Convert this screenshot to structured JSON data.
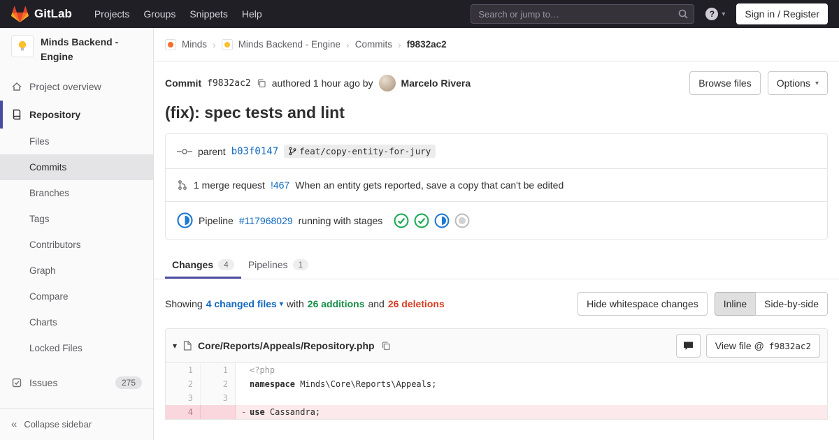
{
  "icons": {
    "caret_down": "▾",
    "chevron_right": "›",
    "collapse": "«",
    "question": "?"
  },
  "navbar": {
    "brand": "GitLab",
    "menu": [
      "Projects",
      "Groups",
      "Snippets",
      "Help"
    ],
    "search_placeholder": "Search or jump to…",
    "signin_label": "Sign in / Register"
  },
  "sidebar": {
    "project_title": "Minds Backend - Engine",
    "overview_label": "Project overview",
    "repository_label": "Repository",
    "repo_items": [
      "Files",
      "Commits",
      "Branches",
      "Tags",
      "Contributors",
      "Graph",
      "Compare",
      "Charts",
      "Locked Files"
    ],
    "issues_label": "Issues",
    "issues_count": "275",
    "collapse_label": "Collapse sidebar"
  },
  "breadcrumb": {
    "group": "Minds",
    "project": "Minds Backend - Engine",
    "section": "Commits",
    "current": "f9832ac2"
  },
  "commit": {
    "label": "Commit",
    "sha": "f9832ac2",
    "authored": "authored 1 hour ago by",
    "author": "Marcelo Rivera",
    "browse_files": "Browse files",
    "options": "Options",
    "title": "(fix): spec tests and lint",
    "parent_label": "parent",
    "parent_sha": "b03f0147",
    "branch_ref": "feat/copy-entity-for-jury",
    "mr_count_text": "1 merge request",
    "mr_ref": "!467",
    "mr_title": "When an entity gets reported, save a copy that can't be edited",
    "pipeline_label": "Pipeline",
    "pipeline_id": "#117968029",
    "pipeline_status_text": "running with stages"
  },
  "tabs": {
    "changes": "Changes",
    "changes_count": "4",
    "pipelines": "Pipelines",
    "pipelines_count": "1"
  },
  "diffstat": {
    "showing": "Showing",
    "changed_files": "4 changed files",
    "with_text": "with",
    "additions": "26 additions",
    "and_text": "and",
    "deletions": "26 deletions",
    "hide_whitespace": "Hide whitespace changes",
    "inline": "Inline",
    "side_by_side": "Side-by-side"
  },
  "diff_file": {
    "path": "Core/Reports/Appeals/Repository.php",
    "view_file_label": "View file @",
    "view_file_sha": "f9832ac2",
    "lines": [
      {
        "old": "1",
        "new": "1",
        "sign": "",
        "kw": "",
        "code": "<?php"
      },
      {
        "old": "2",
        "new": "2",
        "sign": "",
        "kw": "namespace",
        "code": " Minds\\Core\\Reports\\Appeals;"
      },
      {
        "old": "3",
        "new": "3",
        "sign": "",
        "kw": "",
        "code": ""
      },
      {
        "old": "4",
        "new": "",
        "sign": "-",
        "kw": "use",
        "code": " Cassandra;"
      }
    ]
  }
}
